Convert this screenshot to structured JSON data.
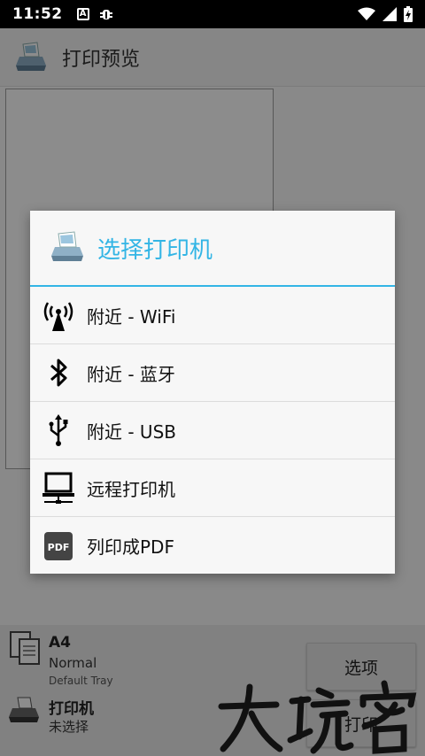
{
  "statusbar": {
    "time": "11:52",
    "icon_a": "A"
  },
  "appbar": {
    "title": "打印预览"
  },
  "bottom": {
    "paper_name": "A4",
    "paper_type": "Normal",
    "paper_tray": "Default Tray",
    "printer_label": "打印机",
    "printer_status": "未选择",
    "options_button": "选项",
    "print_button": "打印"
  },
  "dialog": {
    "title": "选择打印机",
    "items": [
      {
        "label": "附近 - WiFi",
        "icon": "wifi-antenna-icon"
      },
      {
        "label": "附近 - 蓝牙",
        "icon": "bluetooth-icon"
      },
      {
        "label": "附近 - USB",
        "icon": "usb-icon"
      },
      {
        "label": "远程打印机",
        "icon": "remote-computer-icon"
      },
      {
        "label": "列印成PDF",
        "icon": "pdf-icon"
      }
    ]
  },
  "colors": {
    "accent": "#33b5e5"
  }
}
